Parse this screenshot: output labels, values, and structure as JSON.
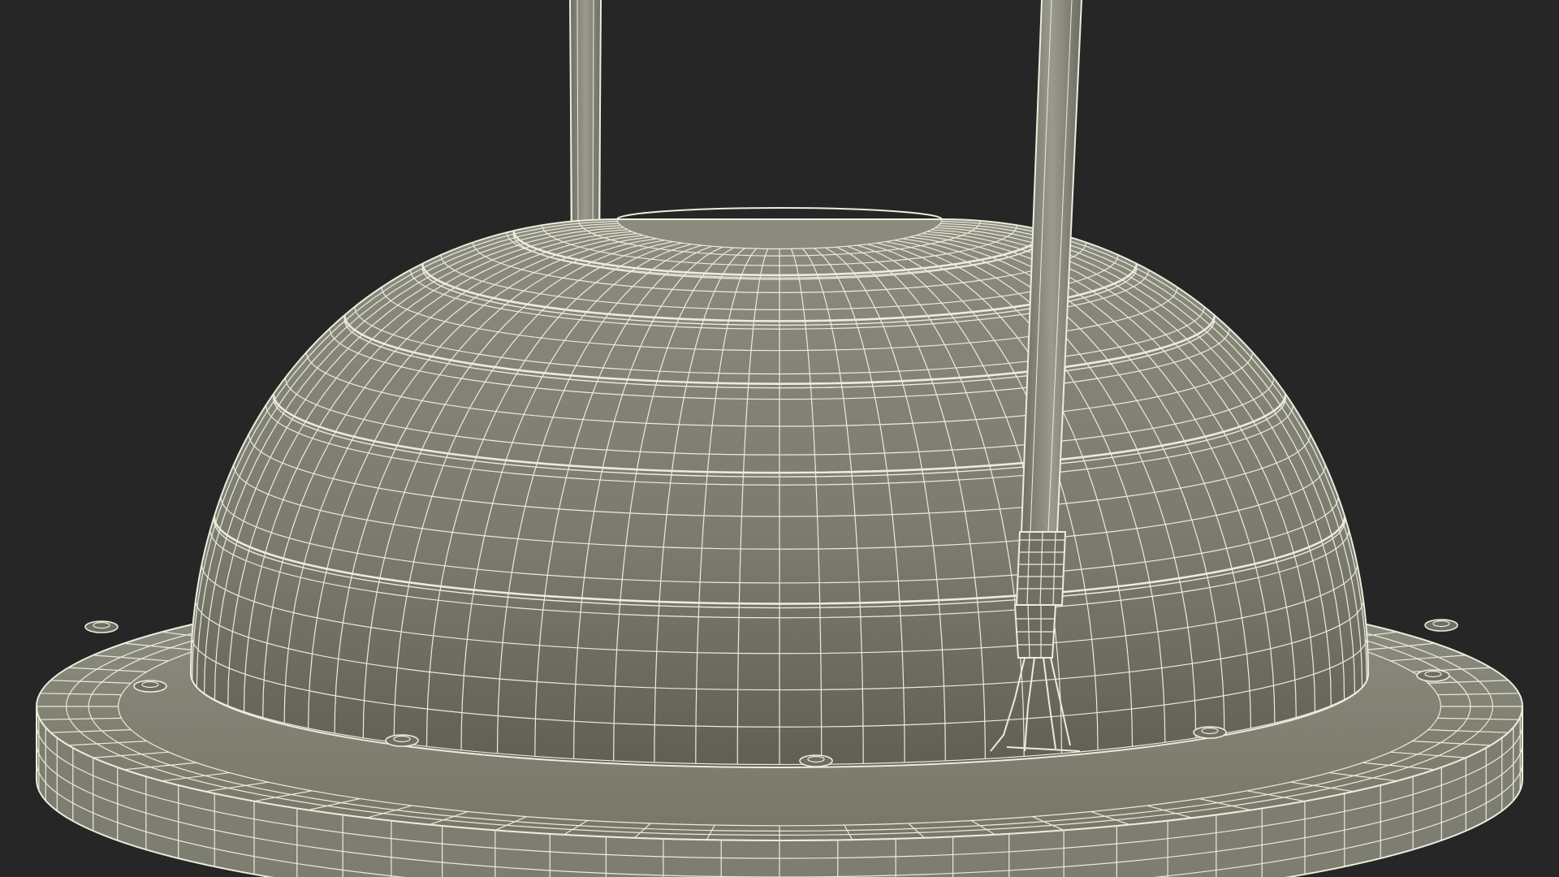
{
  "viewport": {
    "background_color": "#262626"
  },
  "model": {
    "description_icon": "wireframe-dome-lamp-icon",
    "surface_color": "#7b7b70",
    "surface_shadow_color": "#5e5e55",
    "surface_light_color": "#8c8c80",
    "rim_color": "#86867a",
    "wire_color": "#ececdc",
    "rod_color": "#8a8a7e"
  }
}
